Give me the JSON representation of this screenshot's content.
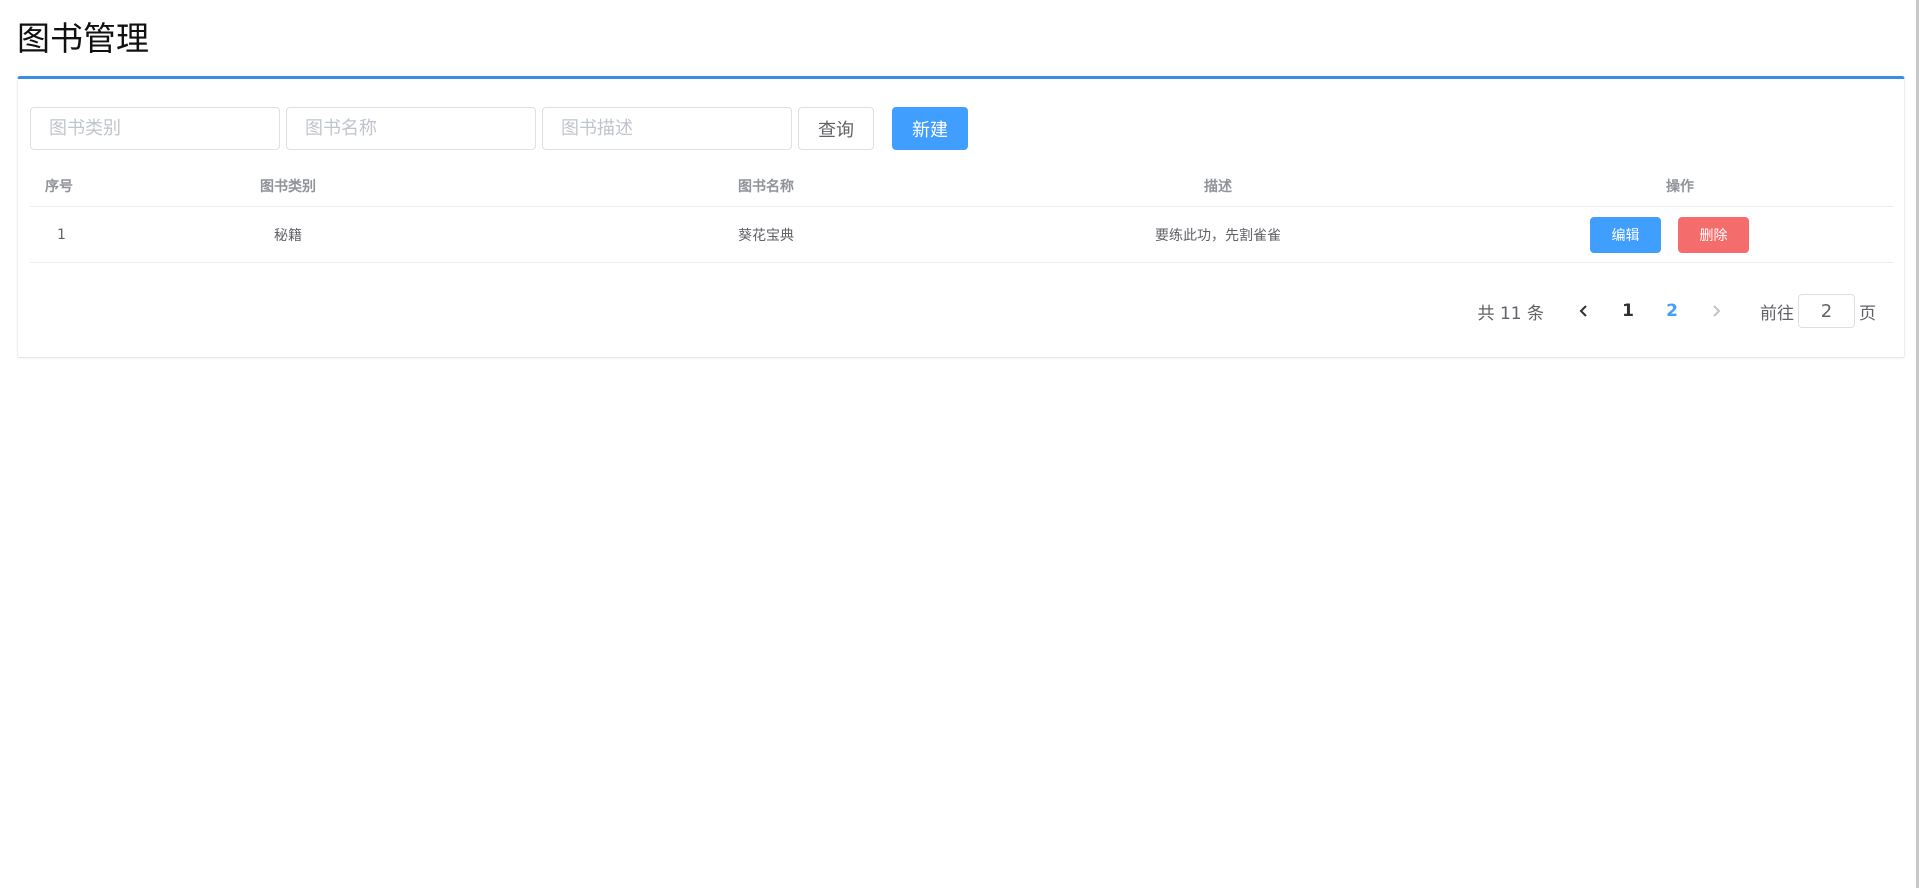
{
  "page": {
    "title": "图书管理"
  },
  "search": {
    "category_placeholder": "图书类别",
    "name_placeholder": "图书名称",
    "description_placeholder": "图书描述",
    "query_label": "查询",
    "new_label": "新建"
  },
  "table": {
    "headers": {
      "index": "序号",
      "category": "图书类别",
      "name": "图书名称",
      "description": "描述",
      "actions": "操作"
    },
    "rows": [
      {
        "index": "1",
        "category": "秘籍",
        "name": "葵花宝典",
        "description": "要练此功，先割雀雀",
        "edit_label": "编辑",
        "delete_label": "删除"
      }
    ]
  },
  "pagination": {
    "total_text": "共 11 条",
    "prev_icon": "chevron-left",
    "next_icon": "chevron-right",
    "pages": [
      "1",
      "2"
    ],
    "current_page": "2",
    "goto_prefix": "前往",
    "goto_value": "2",
    "goto_suffix": "页"
  },
  "colors": {
    "accent": "#409eff",
    "danger": "#f56c6c",
    "panel_border_top": "#3a8ee6"
  }
}
